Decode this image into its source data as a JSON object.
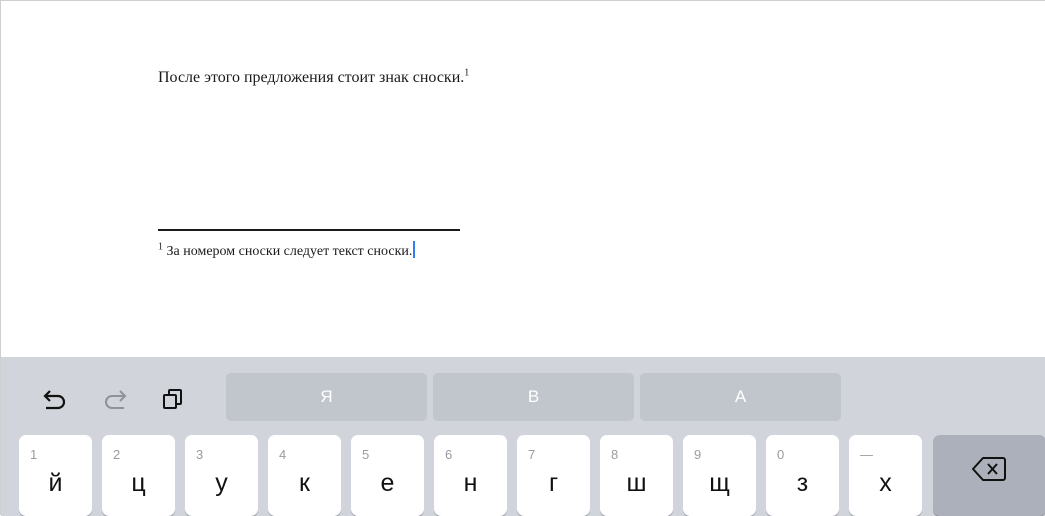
{
  "document": {
    "body_text": "После этого предложения стоит знак сноски.",
    "body_marker": "1",
    "footnote_marker": "1",
    "footnote_text": "За номером сноски следует текст сноски."
  },
  "toolbar": {
    "undo_icon": "undo-icon",
    "redo_icon": "redo-icon",
    "paste_icon": "clipboard-icon"
  },
  "suggestions": [
    "Я",
    "В",
    "А"
  ],
  "keys": [
    {
      "num": "1",
      "letter": "й"
    },
    {
      "num": "2",
      "letter": "ц"
    },
    {
      "num": "3",
      "letter": "у"
    },
    {
      "num": "4",
      "letter": "к"
    },
    {
      "num": "5",
      "letter": "е"
    },
    {
      "num": "6",
      "letter": "н"
    },
    {
      "num": "7",
      "letter": "г"
    },
    {
      "num": "8",
      "letter": "ш"
    },
    {
      "num": "9",
      "letter": "щ"
    },
    {
      "num": "0",
      "letter": "з"
    },
    {
      "num": "—",
      "letter": "х"
    }
  ],
  "backspace_icon": "backspace-icon",
  "colors": {
    "keyboard_bg": "#d1d4da",
    "suggestion_bg": "#c1c5cc",
    "caret": "#2f7cf6"
  }
}
